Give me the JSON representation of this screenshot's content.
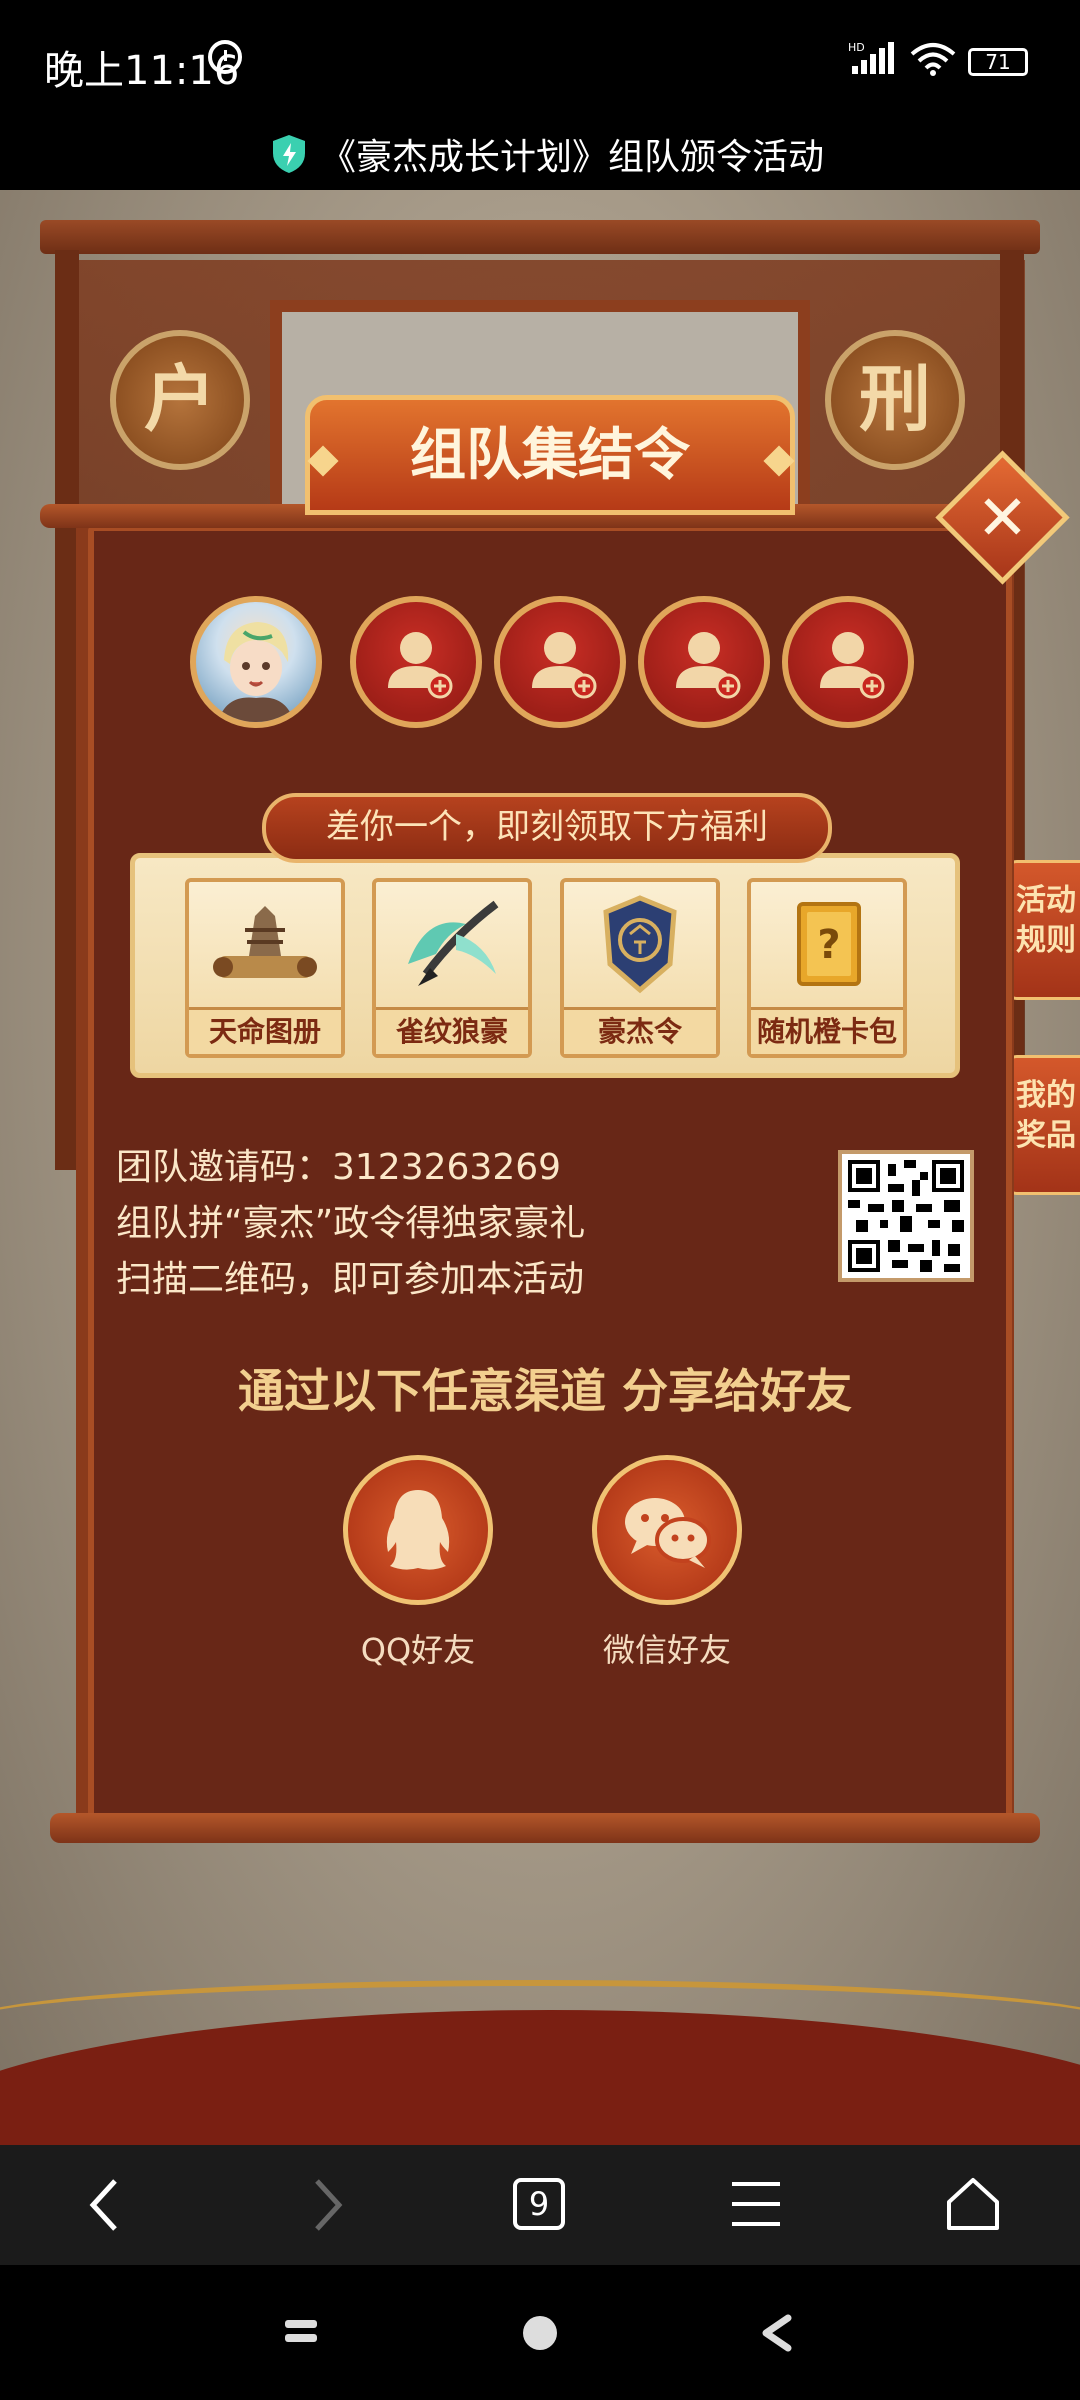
{
  "status": {
    "time": "晚上11:16",
    "battery": "71",
    "signal_label": "HD"
  },
  "header": {
    "title": "《豪杰成长计划》组队颁令活动"
  },
  "scene": {
    "seal_left": "户",
    "seal_right": "刑",
    "side_tab_1": "活动规则",
    "side_tab_2": "我的奖品"
  },
  "dialog": {
    "title": "组队集结令",
    "close": "✕",
    "hint": "差你一个，即刻领取下方福利",
    "rewards": [
      {
        "label": "天命图册",
        "icon": "scroll-icon"
      },
      {
        "label": "雀纹狼豪",
        "icon": "brush-icon"
      },
      {
        "label": "豪杰令",
        "icon": "token-icon"
      },
      {
        "label": "随机橙卡包",
        "icon": "card-pack-icon"
      }
    ],
    "invite_code_line": "团队邀请码：3123263269",
    "line2": "组队拼“豪杰”政令得独家豪礼",
    "line3": "扫描二维码，即可参加本活动",
    "share_title": "通过以下任意渠道 分享给好友",
    "share_qq": "QQ好友",
    "share_wechat": "微信好友"
  },
  "browser_nav": {
    "tabs_count": "9"
  },
  "colors": {
    "panel": "#682717",
    "accent": "#e0a65a",
    "banner": "#d4582b"
  }
}
